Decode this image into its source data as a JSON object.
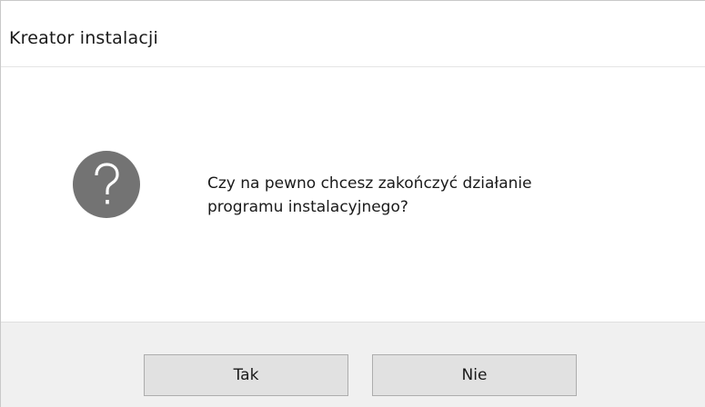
{
  "window": {
    "title": "Kreator instalacji"
  },
  "dialog": {
    "icon": "question-mark-icon",
    "icon_color": "#737373",
    "message_line1": "Czy na pewno chcesz zakończyć działanie",
    "message_line2": "programu instalacyjnego?"
  },
  "buttons": {
    "yes_label": "Tak",
    "no_label": "Nie"
  }
}
